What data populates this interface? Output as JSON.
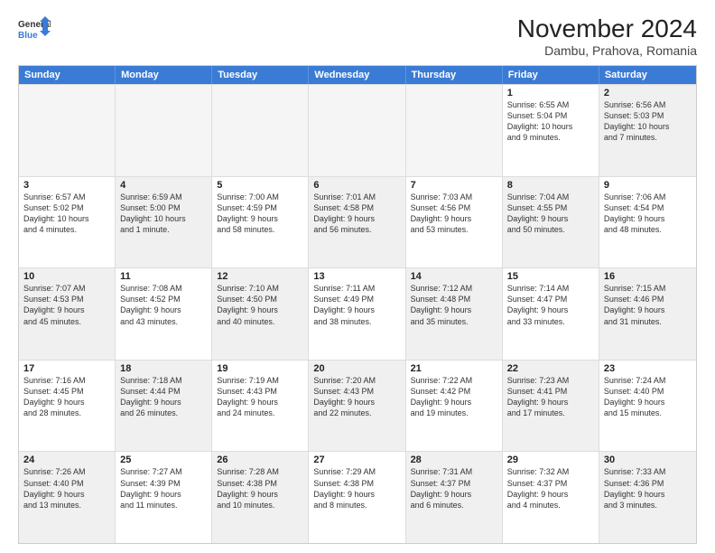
{
  "header": {
    "logo_general": "General",
    "logo_blue": "Blue",
    "month_title": "November 2024",
    "subtitle": "Dambu, Prahova, Romania"
  },
  "days_of_week": [
    "Sunday",
    "Monday",
    "Tuesday",
    "Wednesday",
    "Thursday",
    "Friday",
    "Saturday"
  ],
  "rows": [
    [
      {
        "day": "",
        "info": "",
        "empty": true
      },
      {
        "day": "",
        "info": "",
        "empty": true
      },
      {
        "day": "",
        "info": "",
        "empty": true
      },
      {
        "day": "",
        "info": "",
        "empty": true
      },
      {
        "day": "",
        "info": "",
        "empty": true
      },
      {
        "day": "1",
        "info": "Sunrise: 6:55 AM\nSunset: 5:04 PM\nDaylight: 10 hours\nand 9 minutes."
      },
      {
        "day": "2",
        "info": "Sunrise: 6:56 AM\nSunset: 5:03 PM\nDaylight: 10 hours\nand 7 minutes.",
        "shaded": true
      }
    ],
    [
      {
        "day": "3",
        "info": "Sunrise: 6:57 AM\nSunset: 5:02 PM\nDaylight: 10 hours\nand 4 minutes."
      },
      {
        "day": "4",
        "info": "Sunrise: 6:59 AM\nSunset: 5:00 PM\nDaylight: 10 hours\nand 1 minute.",
        "shaded": true
      },
      {
        "day": "5",
        "info": "Sunrise: 7:00 AM\nSunset: 4:59 PM\nDaylight: 9 hours\nand 58 minutes."
      },
      {
        "day": "6",
        "info": "Sunrise: 7:01 AM\nSunset: 4:58 PM\nDaylight: 9 hours\nand 56 minutes.",
        "shaded": true
      },
      {
        "day": "7",
        "info": "Sunrise: 7:03 AM\nSunset: 4:56 PM\nDaylight: 9 hours\nand 53 minutes."
      },
      {
        "day": "8",
        "info": "Sunrise: 7:04 AM\nSunset: 4:55 PM\nDaylight: 9 hours\nand 50 minutes.",
        "shaded": true
      },
      {
        "day": "9",
        "info": "Sunrise: 7:06 AM\nSunset: 4:54 PM\nDaylight: 9 hours\nand 48 minutes."
      }
    ],
    [
      {
        "day": "10",
        "info": "Sunrise: 7:07 AM\nSunset: 4:53 PM\nDaylight: 9 hours\nand 45 minutes.",
        "shaded": true
      },
      {
        "day": "11",
        "info": "Sunrise: 7:08 AM\nSunset: 4:52 PM\nDaylight: 9 hours\nand 43 minutes."
      },
      {
        "day": "12",
        "info": "Sunrise: 7:10 AM\nSunset: 4:50 PM\nDaylight: 9 hours\nand 40 minutes.",
        "shaded": true
      },
      {
        "day": "13",
        "info": "Sunrise: 7:11 AM\nSunset: 4:49 PM\nDaylight: 9 hours\nand 38 minutes."
      },
      {
        "day": "14",
        "info": "Sunrise: 7:12 AM\nSunset: 4:48 PM\nDaylight: 9 hours\nand 35 minutes.",
        "shaded": true
      },
      {
        "day": "15",
        "info": "Sunrise: 7:14 AM\nSunset: 4:47 PM\nDaylight: 9 hours\nand 33 minutes."
      },
      {
        "day": "16",
        "info": "Sunrise: 7:15 AM\nSunset: 4:46 PM\nDaylight: 9 hours\nand 31 minutes.",
        "shaded": true
      }
    ],
    [
      {
        "day": "17",
        "info": "Sunrise: 7:16 AM\nSunset: 4:45 PM\nDaylight: 9 hours\nand 28 minutes."
      },
      {
        "day": "18",
        "info": "Sunrise: 7:18 AM\nSunset: 4:44 PM\nDaylight: 9 hours\nand 26 minutes.",
        "shaded": true
      },
      {
        "day": "19",
        "info": "Sunrise: 7:19 AM\nSunset: 4:43 PM\nDaylight: 9 hours\nand 24 minutes."
      },
      {
        "day": "20",
        "info": "Sunrise: 7:20 AM\nSunset: 4:43 PM\nDaylight: 9 hours\nand 22 minutes.",
        "shaded": true
      },
      {
        "day": "21",
        "info": "Sunrise: 7:22 AM\nSunset: 4:42 PM\nDaylight: 9 hours\nand 19 minutes."
      },
      {
        "day": "22",
        "info": "Sunrise: 7:23 AM\nSunset: 4:41 PM\nDaylight: 9 hours\nand 17 minutes.",
        "shaded": true
      },
      {
        "day": "23",
        "info": "Sunrise: 7:24 AM\nSunset: 4:40 PM\nDaylight: 9 hours\nand 15 minutes."
      }
    ],
    [
      {
        "day": "24",
        "info": "Sunrise: 7:26 AM\nSunset: 4:40 PM\nDaylight: 9 hours\nand 13 minutes.",
        "shaded": true
      },
      {
        "day": "25",
        "info": "Sunrise: 7:27 AM\nSunset: 4:39 PM\nDaylight: 9 hours\nand 11 minutes."
      },
      {
        "day": "26",
        "info": "Sunrise: 7:28 AM\nSunset: 4:38 PM\nDaylight: 9 hours\nand 10 minutes.",
        "shaded": true
      },
      {
        "day": "27",
        "info": "Sunrise: 7:29 AM\nSunset: 4:38 PM\nDaylight: 9 hours\nand 8 minutes."
      },
      {
        "day": "28",
        "info": "Sunrise: 7:31 AM\nSunset: 4:37 PM\nDaylight: 9 hours\nand 6 minutes.",
        "shaded": true
      },
      {
        "day": "29",
        "info": "Sunrise: 7:32 AM\nSunset: 4:37 PM\nDaylight: 9 hours\nand 4 minutes."
      },
      {
        "day": "30",
        "info": "Sunrise: 7:33 AM\nSunset: 4:36 PM\nDaylight: 9 hours\nand 3 minutes.",
        "shaded": true
      }
    ]
  ]
}
